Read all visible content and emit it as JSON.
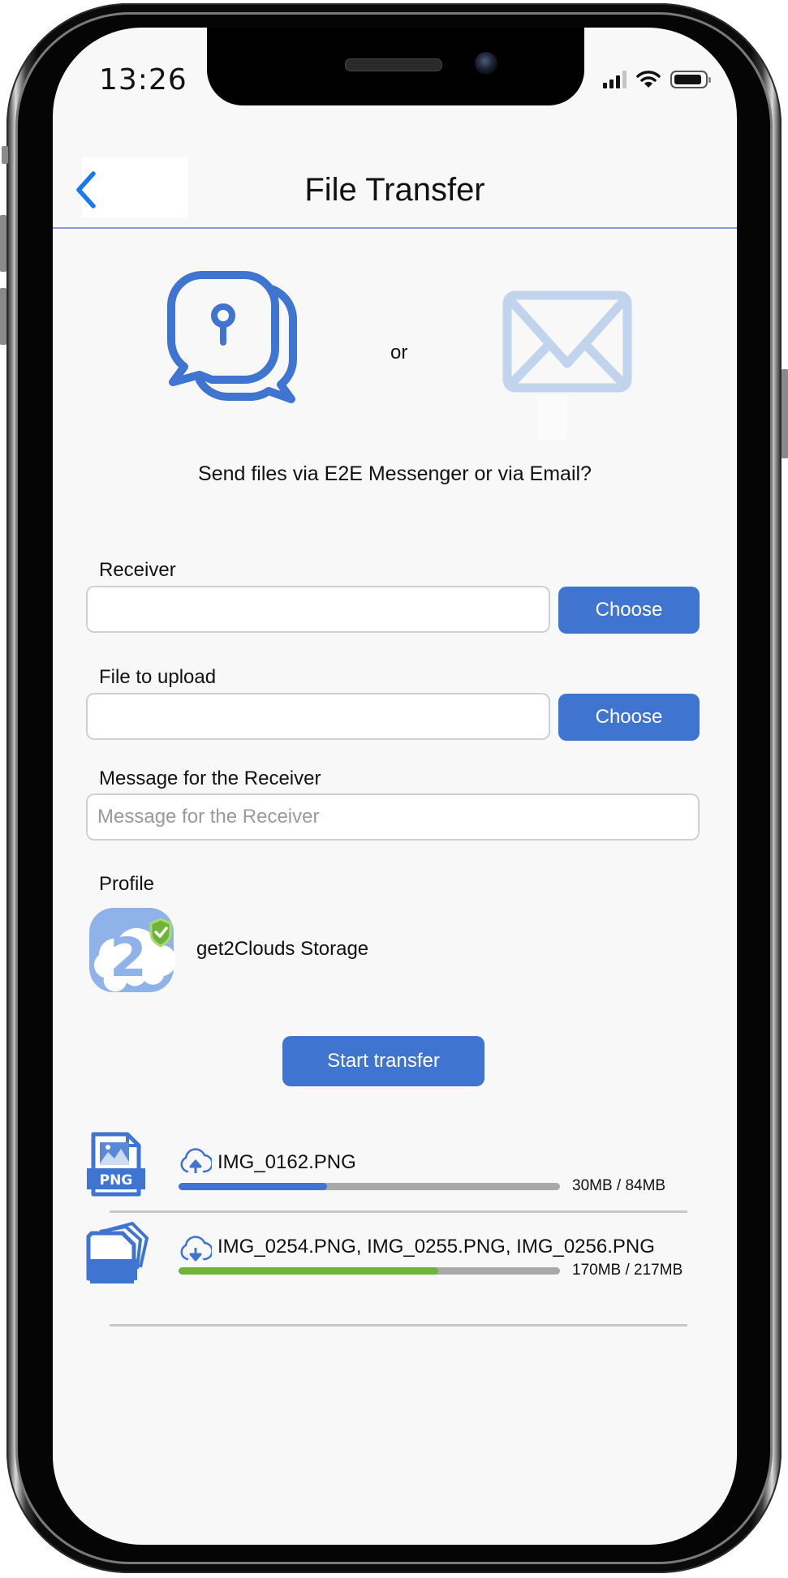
{
  "status_bar": {
    "time": "13:26",
    "icons": [
      "cellular-signal-icon",
      "wifi-icon",
      "battery-icon"
    ]
  },
  "navbar": {
    "back_icon": "chevron-left-icon",
    "title": "File Transfer"
  },
  "send_choice": {
    "messenger_icon": "secure-chat-bubbles-icon",
    "separator": "or",
    "email_icon": "envelope-icon",
    "question": "Send files via E2E Messenger or via Email?"
  },
  "form": {
    "receiver": {
      "label": "Receiver",
      "value": "",
      "placeholder": "",
      "button": "Choose"
    },
    "file": {
      "label": "File to upload",
      "value": "",
      "placeholder": "",
      "button": "Choose"
    },
    "message": {
      "label": "Message for the Receiver",
      "value": "",
      "placeholder": "Message for the Receiver"
    },
    "profile": {
      "label": "Profile",
      "name": "get2Clouds Storage",
      "avatar_icon": "get2clouds-verified-logo"
    },
    "start_button": "Start transfer"
  },
  "transfers": [
    {
      "file_icon": "png-file-icon",
      "direction": "upload",
      "direction_icon": "cloud-upload-icon",
      "name": "IMG_0162.PNG",
      "size_text": "30MB / 84MB",
      "progress": 0.39,
      "bar_color": "#3f74d0"
    },
    {
      "file_icon": "multiple-files-icon",
      "direction": "download",
      "direction_icon": "cloud-download-icon",
      "name": "IMG_0254.PNG, IMG_0255.PNG, IMG_0256.PNG",
      "size_text": "170MB / 217MB",
      "progress": 0.68,
      "bar_color": "#6fb43a"
    }
  ],
  "colors": {
    "accent": "#3f74d0",
    "accent_light": "#c2d3ee",
    "progress_track": "#a9a9a9",
    "success": "#6fb43a",
    "back_chevron": "#1877f2"
  }
}
